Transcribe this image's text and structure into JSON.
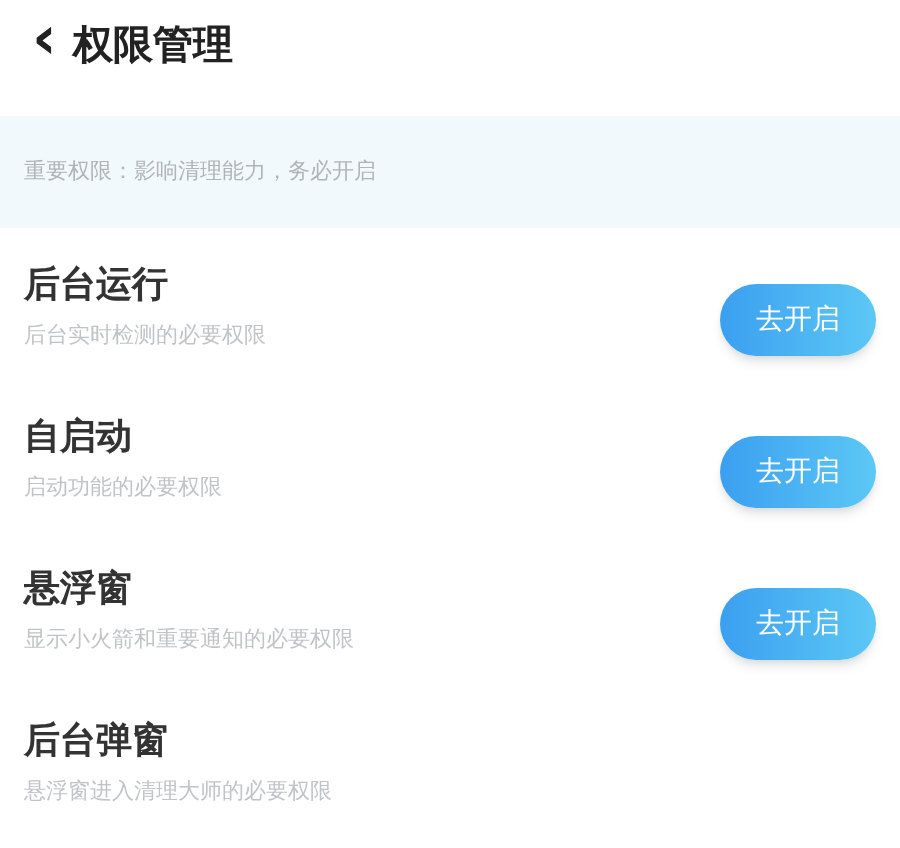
{
  "header": {
    "back": "‹",
    "title": "权限管理"
  },
  "notice": "重要权限：影响清理能力，务必开启",
  "permissions": [
    {
      "title": "后台运行",
      "description": "后台实时检测的必要权限",
      "button": "去开启"
    },
    {
      "title": "自启动",
      "description": "启动功能的必要权限",
      "button": "去开启"
    },
    {
      "title": "悬浮窗",
      "description": "显示小火箭和重要通知的必要权限",
      "button": "去开启"
    },
    {
      "title": "后台弹窗",
      "description": "悬浮窗进入清理大师的必要权限"
    }
  ]
}
